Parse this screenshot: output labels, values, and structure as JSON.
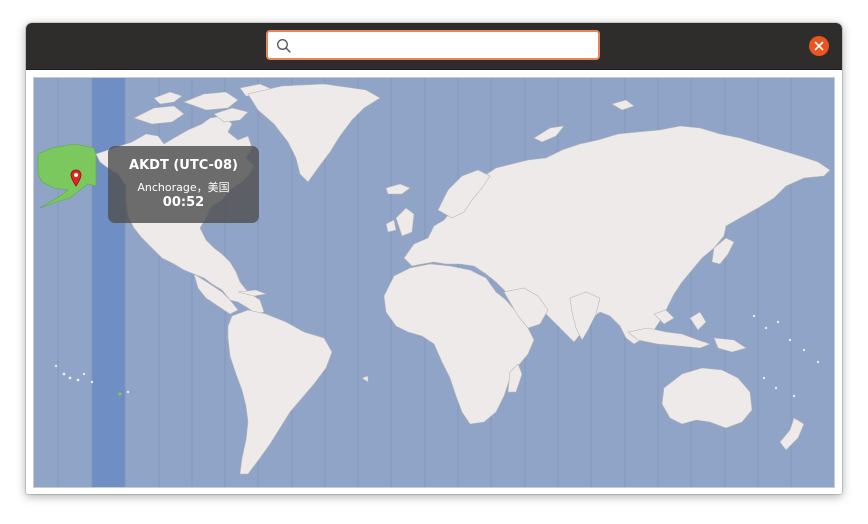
{
  "search": {
    "value": "",
    "placeholder": ""
  },
  "icons": {
    "search": "search-icon",
    "close": "close-icon",
    "pin": "location-pin-icon"
  },
  "colors": {
    "headerbar": "#2f2d2c",
    "search_focus_border": "#e9835d",
    "close_button": "#e95420",
    "ocean": "#8fa4c6",
    "land": "#eeeaea",
    "selected_region": "#7bc95e",
    "selected_timezone_band": "#6f8fc4",
    "pin": "#e42323"
  },
  "selected_location": {
    "timezone": "AKDT (UTC-08)",
    "city": "Anchorage，美国",
    "time": "00:52"
  }
}
